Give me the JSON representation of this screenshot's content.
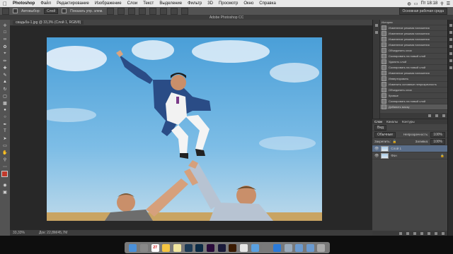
{
  "menubar": {
    "apple": "",
    "app": "Photoshop",
    "items": [
      "Файл",
      "Редактирование",
      "Изображение",
      "Слои",
      "Текст",
      "Выделение",
      "Фильтр",
      "3D",
      "Просмотр",
      "Окно",
      "Справка"
    ],
    "clock": "Пт 18:18",
    "search_icon": "magnifier"
  },
  "optbar": {
    "autoselect_label": "Автовыбор:",
    "autoselect_value": "Слой",
    "transform_label": "Показать упр. элем.",
    "workspace": "Основная рабочая среда"
  },
  "window_title": "Adobe Photoshop CC",
  "document": {
    "tab": "свадьба-1.jpg @ 33,3% (Слой 1, RGB/8)",
    "zoom": "33,33%",
    "doc_size": "Док: 22,8M/45,7M"
  },
  "history": {
    "title": "История",
    "items": [
      "Изменение режима наложения",
      "Изменение режима наложения",
      "Изменение режима наложения",
      "Изменение режима наложения",
      "Объединить слои",
      "Скопировать на новый слой",
      "Удалить слой",
      "Скопировать на новый слой",
      "Изменение режима наложения",
      "Инвертировать",
      "Изменить основные непрозрачность",
      "Объединить слои",
      "Кривые",
      "Скопировать на новый слой",
      "Добавить маску"
    ]
  },
  "layers": {
    "tabs": [
      "Слои",
      "Каналы",
      "Контуры"
    ],
    "filter": "Вид",
    "blend": "Обычные",
    "opacity_label": "Непрозрачность:",
    "opacity": "100%",
    "lock_label": "Закрепить:",
    "fill_label": "Заливка:",
    "fill": "100%",
    "rows": [
      {
        "name": "Слой 1"
      },
      {
        "name": "Фон"
      }
    ]
  },
  "dock": {
    "apps": [
      "finder-icon",
      "launchpad-icon",
      "calendar-icon",
      "photos-icon",
      "notes-icon",
      "lightroom-icon",
      "photoshop-icon",
      "premiere-icon",
      "aftereffects-icon",
      "illustrator-icon",
      "itunes-icon",
      "safari-icon",
      "systemprefs-icon",
      "appstore-icon",
      "mail-icon",
      "documents-icon",
      "downloads-icon",
      "trash-icon"
    ],
    "calendar_day": "27"
  }
}
